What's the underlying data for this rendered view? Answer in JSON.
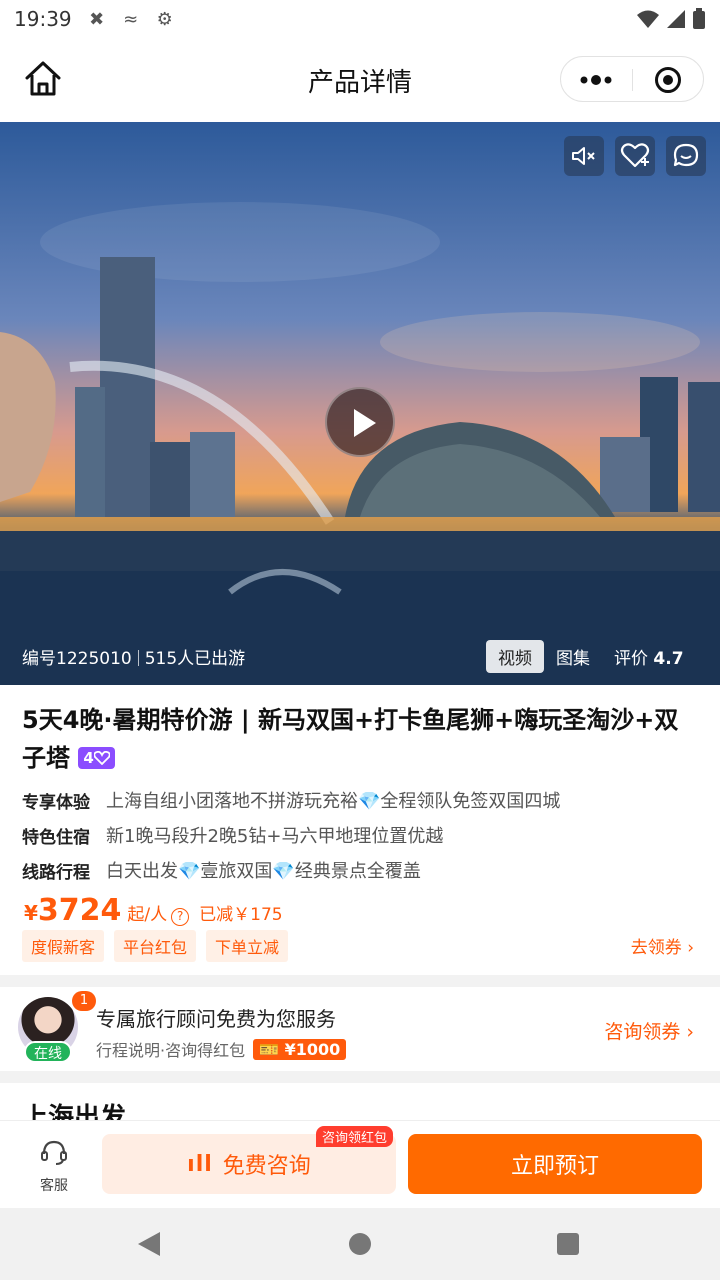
{
  "status_bar": {
    "time": "19:39"
  },
  "nav": {
    "title": "产品详情"
  },
  "hero": {
    "code": "编号1225010",
    "travelers": "515人已出游",
    "tabs": [
      "视频",
      "图集"
    ],
    "rating_label": "评价",
    "rating_value": "4.7"
  },
  "product": {
    "title": "5天4晚·暑期特价游 | 新马双国+打卡鱼尾狮+嗨玩圣淘沙+双子塔",
    "level": "4",
    "features": [
      {
        "label": "专享体验",
        "text": "上海自组小团落地不拼游玩充裕💎全程领队免签双国四城"
      },
      {
        "label": "特色住宿",
        "text": "新1晚马段升2晚5钻+马六甲地理位置优越"
      },
      {
        "label": "线路行程",
        "text": "白天出发💎壹旅双国💎经典景点全覆盖"
      }
    ],
    "price_symbol": "¥",
    "price": "3724",
    "price_unit": "起/人",
    "saved": "已减￥175",
    "tags": [
      "度假新客",
      "平台红包",
      "下单立减"
    ],
    "coupon_link": "去领券 ›"
  },
  "advisor": {
    "badge": "1",
    "online": "在线",
    "title": "专属旅行顾问免费为您服务",
    "subtitle": "行程说明·咨询得红包",
    "red_packet": "¥1000",
    "link": "咨询领券 ›"
  },
  "departure": {
    "title": "上海出发"
  },
  "action_bar": {
    "service_label": "客服",
    "consult_label": "免费咨询",
    "consult_badge": "咨询领红包",
    "book_label": "立即预订"
  },
  "colors": {
    "accent": "#ff6a00",
    "accent_text": "#ff5a0b",
    "tag_bg": "#fff0e6",
    "online": "#22b35a",
    "level": "#8b4dff"
  }
}
